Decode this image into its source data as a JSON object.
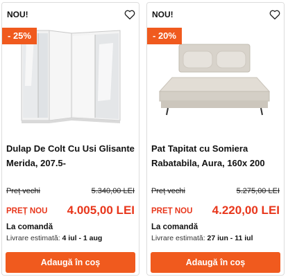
{
  "products": [
    {
      "badge": "NOU!",
      "discount": "- 25%",
      "title": "Dulap De Colt Cu Usi Glisante Merida, 207.5-",
      "old_label": "Preț vechi",
      "old_price": "5.340,00 LEI",
      "new_label": "PREȚ NOU",
      "new_price": "4.005,00 LEI",
      "stock": "La comandă",
      "delivery_label": "Livrare estimată:",
      "delivery_dates": "4 iul - 1 aug",
      "cart_label": "Adaugă în coș",
      "fav_icon": "heart-outline-icon"
    },
    {
      "badge": "NOU!",
      "discount": "- 20%",
      "title": "Pat Tapitat cu Somiera Rabatabila, Aura, 160x 200",
      "old_label": "Preț vechi",
      "old_price": "5.275,00 LEI",
      "new_label": "PREȚ NOU",
      "new_price": "4.220,00 LEI",
      "stock": "La comandă",
      "delivery_label": "Livrare estimată:",
      "delivery_dates": "27 iun - 11 iul",
      "cart_label": "Adaugă în coș",
      "fav_icon": "heart-outline-icon"
    }
  ],
  "colors": {
    "accent": "#f05a1e",
    "price_red": "#e8361b"
  }
}
